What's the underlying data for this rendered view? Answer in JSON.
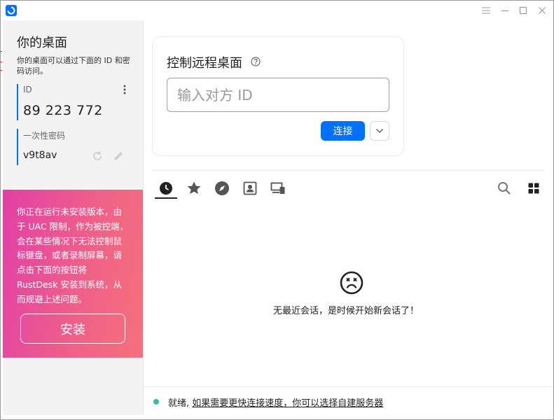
{
  "left": {
    "title": "你的桌面",
    "description": "你的桌面可以通过下面的 ID 和密码访问。",
    "id_label": "ID",
    "id_value": "89 223 772",
    "password_label": "一次性密码",
    "password_value": "v9t8av",
    "promo_text": "你正在运行未安装版本，由于 UAC 限制，作为被控端，会在某些情况下无法控制鼠标键盘，或者录制屏幕，请点击下面的按钮将 RustDesk 安装到系统，从而规避上述问题。",
    "install_label": "安装"
  },
  "control": {
    "title": "控制远程桌面",
    "id_placeholder": "输入对方 ID",
    "connect_label": "连接"
  },
  "sessions": {
    "empty_message": "无最近会话，是时候开始新会话了！"
  },
  "status": {
    "ready": "就绪,",
    "link": "如果需要更快连接速度，你可以选择自建服务器"
  },
  "colors": {
    "accent": "#0071ff",
    "status_dot": "#32bea6",
    "promo_gradient_start": "#e23fa6",
    "promo_gradient_end": "#f5717a"
  }
}
